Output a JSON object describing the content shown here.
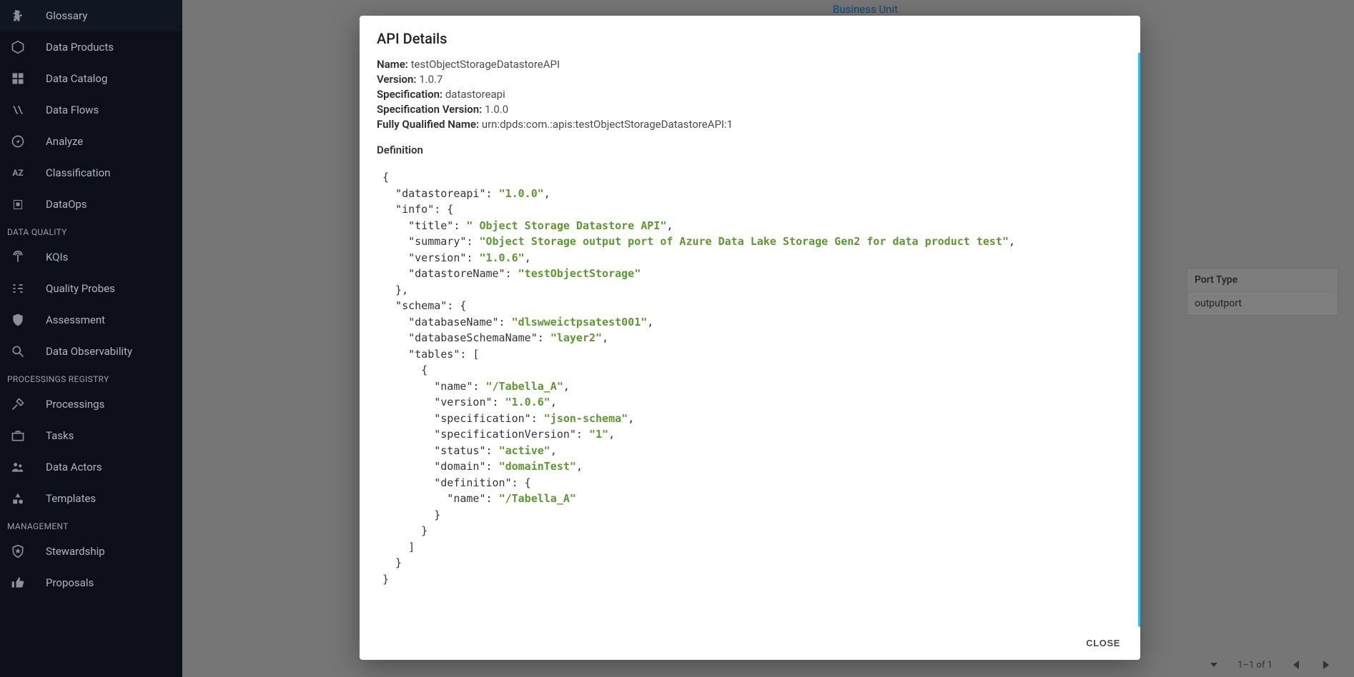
{
  "sidebar": {
    "items": [
      {
        "label": "Glossary",
        "icon": "puzzle-icon"
      },
      {
        "label": "Data Products",
        "icon": "hexagon-icon"
      },
      {
        "label": "Data Catalog",
        "icon": "grid-icon"
      },
      {
        "label": "Data Flows",
        "icon": "flow-icon"
      },
      {
        "label": "Analyze",
        "icon": "compass-icon"
      },
      {
        "label": "Classification",
        "icon": "az-icon"
      },
      {
        "label": "DataOps",
        "icon": "dataops-icon"
      }
    ],
    "section_dq": "DATA QUALITY",
    "items_dq": [
      {
        "label": "KQIs",
        "icon": "antenna-icon"
      },
      {
        "label": "Quality Probes",
        "icon": "equalizer-icon"
      },
      {
        "label": "Assessment",
        "icon": "shield-icon"
      },
      {
        "label": "Data Observability",
        "icon": "search-cog-icon"
      }
    ],
    "section_pr": "PROCESSINGS REGISTRY",
    "items_pr": [
      {
        "label": "Processings",
        "icon": "tools-icon"
      },
      {
        "label": "Tasks",
        "icon": "briefcase-icon"
      },
      {
        "label": "Data Actors",
        "icon": "people-icon"
      },
      {
        "label": "Templates",
        "icon": "shapes-icon"
      }
    ],
    "section_mg": "MANAGEMENT",
    "items_mg": [
      {
        "label": "Stewardship",
        "icon": "star-badge-icon"
      },
      {
        "label": "Proposals",
        "icon": "thumbs-icon"
      }
    ]
  },
  "background": {
    "business_unit_link": "Business Unit",
    "right_panel": {
      "header": "Port Type",
      "value": "outputport"
    },
    "pager": {
      "range": "1–1 of 1"
    }
  },
  "modal": {
    "title": "API Details",
    "fields": {
      "name_label": "Name:",
      "name_value": "testObjectStorageDatastoreAPI",
      "version_label": "Version:",
      "version_value": "1.0.7",
      "spec_label": "Specification:",
      "spec_value": "datastoreapi",
      "specv_label": "Specification Version:",
      "specv_value": "1.0.0",
      "fqn_label": "Fully Qualified Name:",
      "fqn_value": "urn:dpds:com.:apis:testObjectStorageDatastoreAPI:1"
    },
    "definition_heading": "Definition",
    "close_label": "CLOSE",
    "definition": {
      "datastoreapi": "1.0.0",
      "info": {
        "title": " Object Storage Datastore API",
        "summary": "Object Storage output port of Azure Data Lake Storage Gen2 for data product test",
        "version": "1.0.6",
        "datastoreName": "testObjectStorage"
      },
      "schema": {
        "databaseName": "dlswweictpsatest001",
        "databaseSchemaName": "layer2",
        "tables": [
          {
            "name": "/Tabella_A",
            "version": "1.0.6",
            "specification": "json-schema",
            "specificationVersion": "1",
            "status": "active",
            "domain": "domainTest",
            "definition": {
              "name": "/Tabella_A"
            }
          }
        ]
      }
    }
  }
}
